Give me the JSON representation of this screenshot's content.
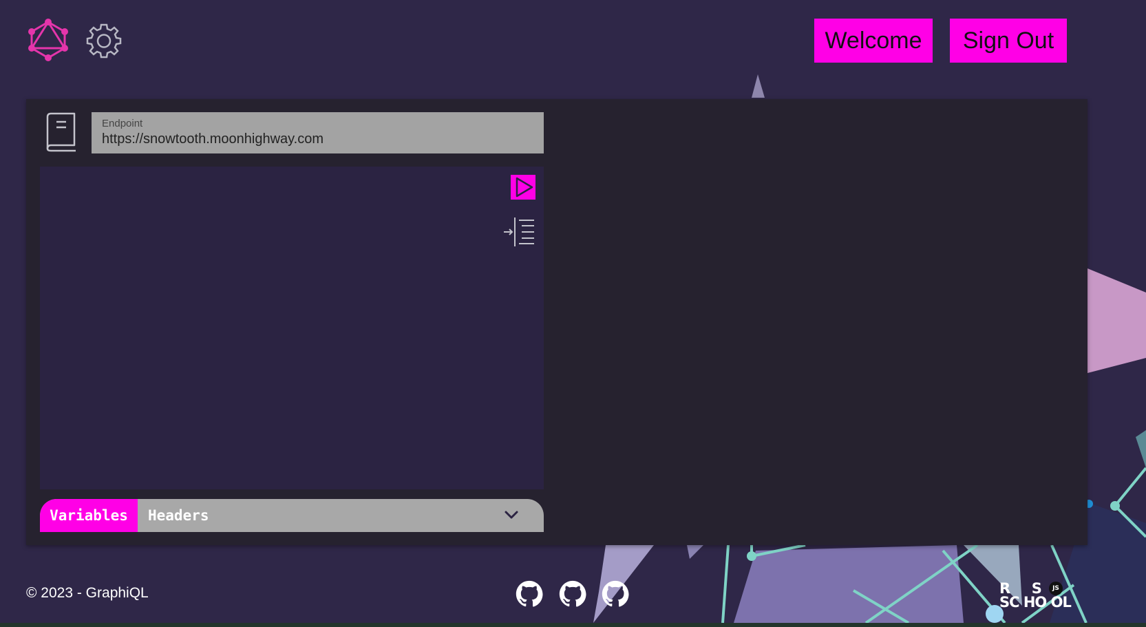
{
  "header": {
    "welcome_label": "Welcome",
    "signout_label": "Sign Out"
  },
  "endpoint": {
    "label": "Endpoint",
    "value": "https://snowtooth.moonhighway.com"
  },
  "editor": {
    "query": ""
  },
  "tabs": [
    {
      "label": "Variables",
      "active": true
    },
    {
      "label": "Headers",
      "active": false
    }
  ],
  "footer": {
    "copyright": "© 2023 - GraphiQL",
    "github_links": 3,
    "school_top": "R     S",
    "school_bottom": "SC HO OL",
    "school_badge": "JS"
  },
  "colors": {
    "accent": "#ff00e6",
    "background": "#2f2748",
    "panel": "#26222f",
    "editor": "#2b2342",
    "logo": "#e535ab"
  },
  "icons": [
    "graphql-logo-icon",
    "gear-icon",
    "book-icon",
    "play-icon",
    "prettify-icon",
    "chevron-down-icon",
    "github-icon"
  ]
}
